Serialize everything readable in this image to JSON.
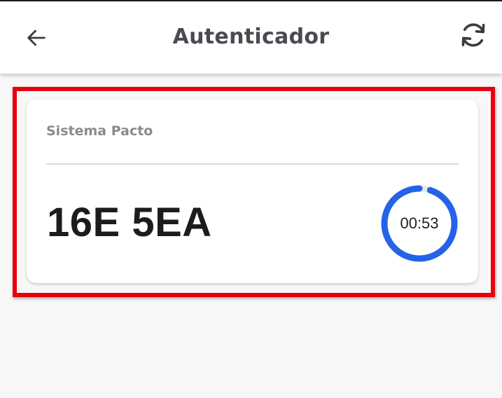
{
  "header": {
    "title": "Autenticador",
    "back_icon": "arrow-left-icon",
    "refresh_icon": "refresh-icon"
  },
  "accounts": [
    {
      "service": "Sistema Pacto",
      "code": "16E 5EA",
      "timer_label": "00:53",
      "remaining_fraction": 0.95
    }
  ],
  "colors": {
    "accent": "#2463e8",
    "highlight": "#e8000b",
    "track": "#e7e9ee"
  }
}
